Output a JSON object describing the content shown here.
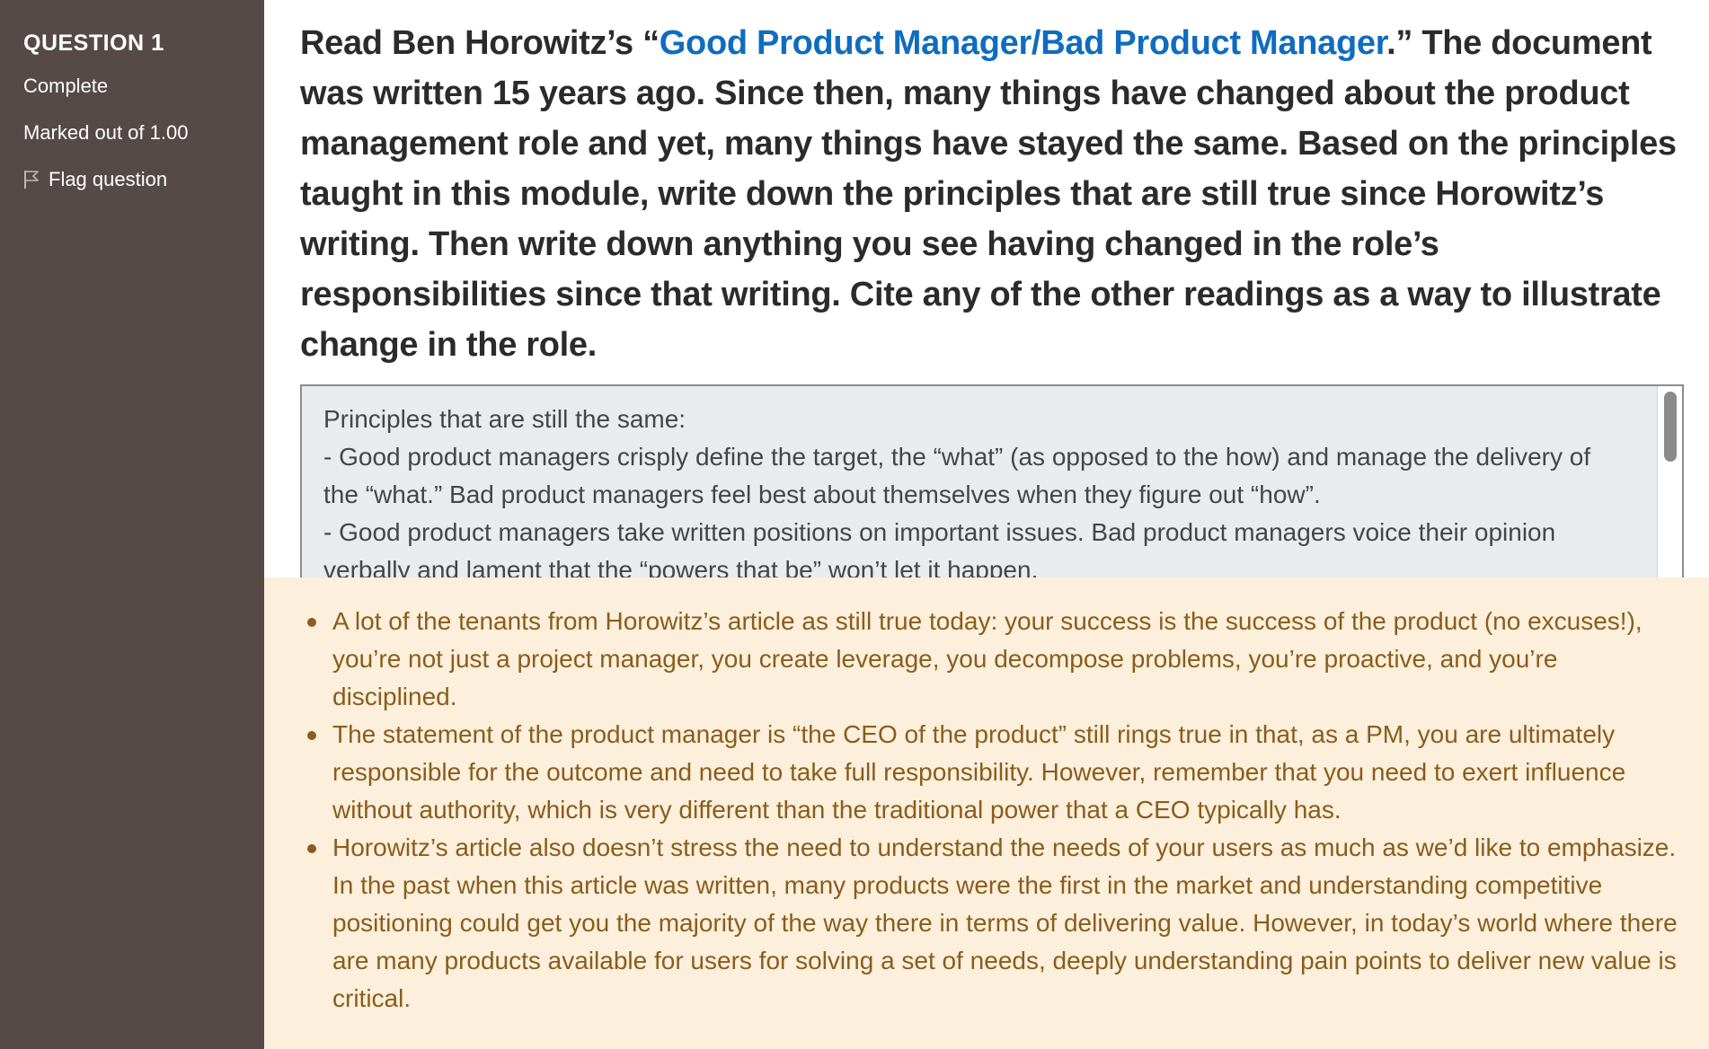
{
  "info": {
    "question_prefix": "QUESTION",
    "question_number": "1",
    "state": "Complete",
    "grade": "Marked out of 1.00",
    "flag_label": "Flag question"
  },
  "question": {
    "text_before": "Read Ben Horowitz’s “",
    "link_text": "Good Product Manager/Bad Product Manager",
    "text_after": ".” The document was written 15 years ago. Since then, many things have changed about the product management role and yet, many things have stayed the same. Based on the principles taught in this module, write down the principles that are still true since Horowitz’s writing. Then write down anything you see having changed in the role’s responsibilities since that writing. Cite any of the other readings as a way to illustrate change in the role."
  },
  "answer": {
    "text": "Principles that are still the same:\n- Good product managers crisply define the target, the “what” (as opposed to the how) and manage the delivery of the “what.” Bad product managers feel best about themselves when they figure out “how”.\n- Good product managers take written positions on important issues. Bad product managers voice their opinion verbally and lament that the “powers that be” won’t let it happen."
  },
  "feedback": {
    "items": [
      "A lot of the tenants from Horowitz’s article as still true today: your success is the success of the product (no excuses!), you’re not just a project manager, you create leverage, you decompose problems, you’re proactive, and you’re disciplined.",
      "The statement of the product manager is “the CEO of the product” still rings true in that, as a PM, you are ultimately responsible for the outcome and need to take full responsibility. However, remember that you need to exert influence without authority, which is very different than the traditional power that a CEO typically has.",
      "Horowitz’s article also doesn’t stress the need to understand the needs of your users as much as we’d like to emphasize. In the past when this article was written, many products were the first in the market and understanding competitive positioning could get you the majority of the way there in terms of delivering value. However, in today’s world where there are many products available for users for solving a set of needs, deeply understanding pain points to deliver new value is critical."
    ]
  },
  "colors": {
    "sidebar_bg": "#554a48",
    "link": "#0f6cbf",
    "feedback_bg": "#fcefdc",
    "feedback_text": "#8a5d1b",
    "answer_bg": "#e9ebef"
  }
}
